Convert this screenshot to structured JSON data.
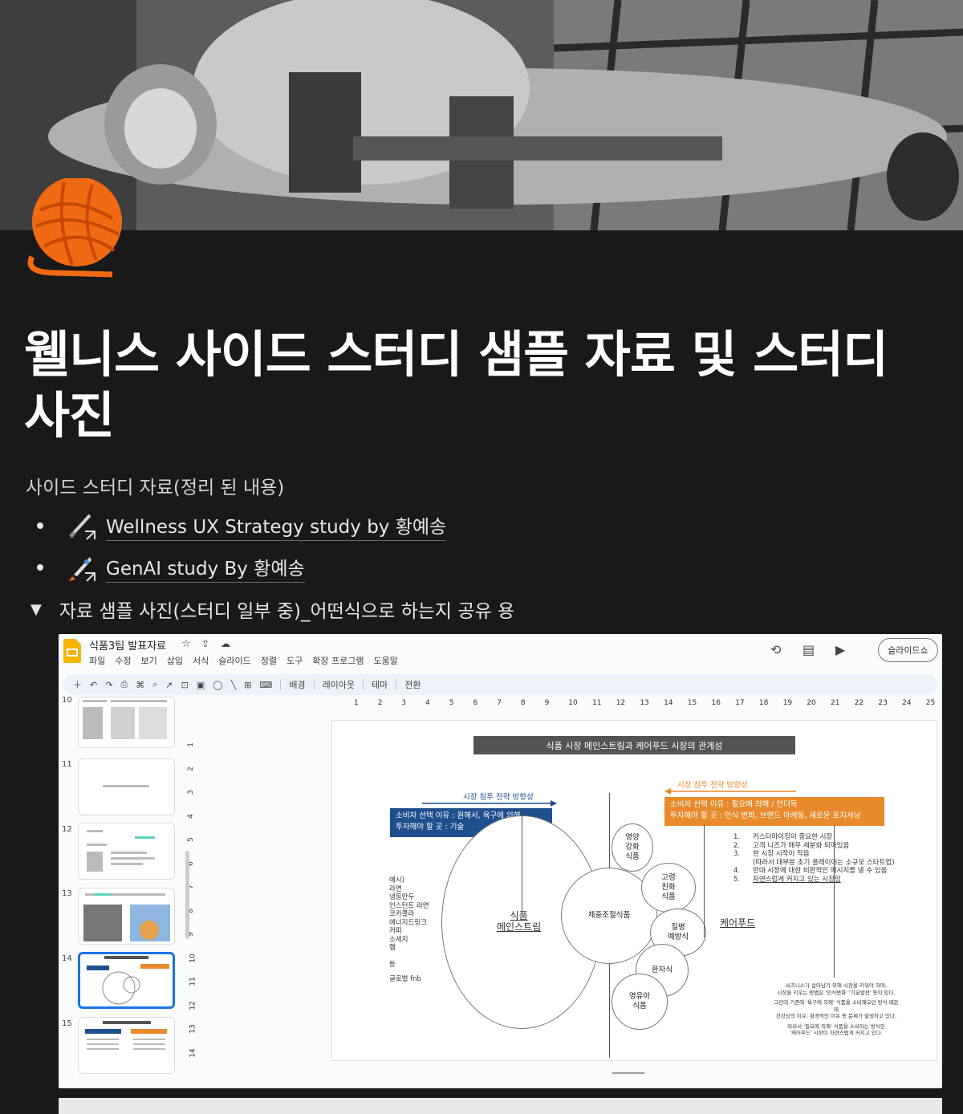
{
  "page": {
    "title": "웰니스 사이드 스터디 샘플 자료 및 스터디 사진",
    "intro": "사이드 스터디 자료(정리 된 내용)",
    "icon": "yarn-ball-icon",
    "links": [
      {
        "label": "Wellness UX Strategy study by 황예송",
        "icon": "paintbrush-link-icon"
      },
      {
        "label": "GenAI study By 황예송",
        "icon": "rocket-link-icon"
      }
    ],
    "toggle": {
      "label": "자료 샘플 사진(스터디 일부 중)_어떤식으로 하는지 공유 용",
      "icon": "triangle-down-icon"
    }
  },
  "slides_app": {
    "doc_title": "식품3팀 발표자료",
    "menu": [
      "파일",
      "수정",
      "보기",
      "삽입",
      "서식",
      "슬라이드",
      "정렬",
      "도구",
      "확장 프로그램",
      "도움말"
    ],
    "toolbar_text": [
      "배경",
      "레이아웃",
      "테마",
      "전환"
    ],
    "slideshow_button": "슬라이드쇼",
    "ruler_numbers": [
      "1",
      "2",
      "3",
      "4",
      "5",
      "6",
      "7",
      "8",
      "9",
      "10",
      "11",
      "12",
      "13",
      "14",
      "15",
      "16",
      "17",
      "18",
      "19",
      "20",
      "21",
      "22",
      "23",
      "24",
      "25"
    ],
    "vruler_numbers": [
      "1",
      "2",
      "3",
      "4",
      "5",
      "6",
      "7",
      "8",
      "9",
      "10",
      "11",
      "12",
      "13",
      "14"
    ],
    "thumbnails": [
      "10",
      "11",
      "12",
      "13",
      "14",
      "15"
    ],
    "accent": "#1a73e8"
  },
  "slide": {
    "header": "식품 시장 메인스트림과 케어푸드 시장의 관계성",
    "left_arrow_label": "시장 침투 전략 방향성",
    "right_arrow_label": "시장 침투 전략 방향성",
    "blue_box_line1": "소비자 선택 이유 : 원해서, 욕구에 의해",
    "blue_box_line2": "투자해야 할 곳 : 기술",
    "orange_box_line1": "소비자 선택 이유 : 필요에 의해 / 언더독",
    "orange_box_line2": "투자해야 할 곳 : 인식 변화, 브랜드 마케팅, 새로운 포지셔닝",
    "examples": [
      "예시)",
      "라면",
      "냉동만두",
      "인스턴트 라면",
      "코카콜라",
      "에너지드링크",
      "커피",
      "소세지",
      "햄",
      "등",
      "글로벌 fnb"
    ],
    "big_circle": "식품\n메인스트림",
    "mid_circle": "체중조절식품",
    "small_circles": [
      "영양\n강화\n식품",
      "고령\n친화\n식품",
      "질병\n예방식",
      "환자식",
      "영유아\n식품"
    ],
    "carefood": "케어푸드",
    "list": [
      "커스터마이징이 중요한 시장",
      "고객 니즈가 매우 세분화 되어있음",
      "한 시장 시작이 작음",
      "(따라서 대부분 초기 플레이어는 소규모 스타트업)",
      "반대 시장에 대한 비판적인 메시지를 낼 수 있음",
      "자연스럽게 커지고 있는 시장임"
    ],
    "list_nums": [
      "1.",
      "2.",
      "3.",
      "",
      "4.",
      "5."
    ],
    "notes": [
      "비즈니스가 살아남기 위해 시장을 키워야 하며,",
      "시장을 키우는 방법은 '인식변화' '기술발전' 등이 있다.",
      "그런데 기존에 '욕구에 의해' 식품을 소비해오던 방식 때문에",
      "건강상의 이유, 환경적인 이유 등 문제가 발생하고 있다.",
      "따라서 '필요에 의해' 식품을 소비하는 방식인",
      "'케어푸드' 시장이 자연스럽게 커지고 있다."
    ],
    "colors": {
      "blue": "#1f4f8f",
      "orange": "#e88a2b",
      "header": "#545454"
    }
  }
}
